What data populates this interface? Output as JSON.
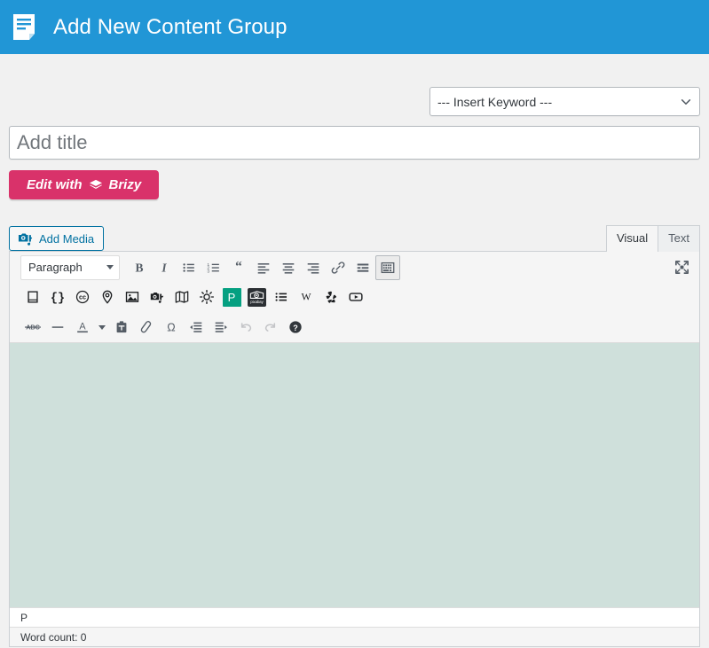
{
  "header": {
    "title": "Add New Content Group",
    "icon": "document-lines-icon",
    "background_color": "#2196d6"
  },
  "keyword_select": {
    "name": "insert-keyword-select",
    "selected": "--- Insert Keyword ---",
    "icon": "chevron-down-icon"
  },
  "title_field": {
    "placeholder": "Add title",
    "value": ""
  },
  "brizy_button": {
    "label_before": "Edit with",
    "label_after": "Brizy",
    "icon": "brizy-layers-icon",
    "color": "#d9326a"
  },
  "editor": {
    "add_media_label": "Add Media",
    "add_media_icon": "media-camera-note-icon",
    "accent_color": "#0071a1",
    "tabs": [
      {
        "label": "Visual",
        "active": true
      },
      {
        "label": "Text",
        "active": false
      }
    ],
    "format_select": {
      "value": "Paragraph",
      "icon": "caret-down-icon"
    },
    "toolbar_row1": [
      {
        "name": "bold-button",
        "title": "Bold"
      },
      {
        "name": "italic-button",
        "title": "Italic"
      },
      {
        "name": "bulleted-list-button",
        "title": "Bulleted list"
      },
      {
        "name": "numbered-list-button",
        "title": "Numbered list"
      },
      {
        "name": "blockquote-button",
        "title": "Blockquote"
      },
      {
        "name": "align-left-button",
        "title": "Align left"
      },
      {
        "name": "align-center-button",
        "title": "Align center"
      },
      {
        "name": "align-right-button",
        "title": "Align right"
      },
      {
        "name": "insert-link-button",
        "title": "Insert/edit link"
      },
      {
        "name": "read-more-button",
        "title": "Insert Read More tag"
      },
      {
        "name": "toolbar-toggle-button",
        "title": "Toolbar Toggle",
        "active": true
      }
    ],
    "toolbar_row2": [
      {
        "name": "book-button",
        "title": "Book"
      },
      {
        "name": "code-braces-button",
        "title": "Code"
      },
      {
        "name": "creative-commons-button",
        "title": "Creative Commons"
      },
      {
        "name": "map-pin-button",
        "title": "Location"
      },
      {
        "name": "image-button",
        "title": "Image"
      },
      {
        "name": "media-button",
        "title": "Media"
      },
      {
        "name": "map-button",
        "title": "Map"
      },
      {
        "name": "weather-sun-button",
        "title": "Weather"
      },
      {
        "name": "pexels-button",
        "title": "Pexels"
      },
      {
        "name": "pixabay-button",
        "title": "Pixabay"
      },
      {
        "name": "list-button",
        "title": "List"
      },
      {
        "name": "wikipedia-button",
        "title": "Wikipedia"
      },
      {
        "name": "yelp-button",
        "title": "Yelp"
      },
      {
        "name": "youtube-button",
        "title": "YouTube"
      }
    ],
    "toolbar_row3": [
      {
        "name": "strikethrough-button",
        "title": "Strikethrough"
      },
      {
        "name": "horizontal-rule-button",
        "title": "Horizontal line"
      },
      {
        "name": "text-color-button",
        "title": "Text color"
      },
      {
        "name": "paste-as-text-button",
        "title": "Paste as text"
      },
      {
        "name": "clear-formatting-button",
        "title": "Clear formatting"
      },
      {
        "name": "special-character-button",
        "title": "Special character"
      },
      {
        "name": "outdent-button",
        "title": "Decrease indent"
      },
      {
        "name": "indent-button",
        "title": "Increase indent"
      },
      {
        "name": "undo-button",
        "title": "Undo",
        "disabled": true
      },
      {
        "name": "redo-button",
        "title": "Redo",
        "disabled": true
      },
      {
        "name": "keyboard-shortcuts-button",
        "title": "Keyboard Shortcuts"
      }
    ],
    "fullscreen_icon": "distraction-free-icon",
    "strikethrough_label": "ABC",
    "text_color_letter": "A",
    "pexels_letter": "P",
    "pixabay_label": "pixabay",
    "wikipedia_letter": "W",
    "path": "P",
    "word_count": "Word count: 0",
    "body_background": "#cfe0db"
  }
}
